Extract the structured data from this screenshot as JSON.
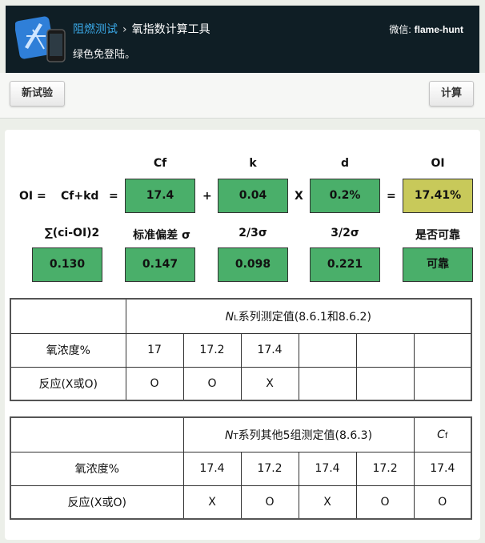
{
  "header": {
    "breadcrumb_link": "阻燃测试",
    "breadcrumb_sep": "›",
    "title": "氧指数计算工具",
    "subtitle": "绿色免登陆。",
    "wechat_label": "微信:",
    "wechat_id": "flame-hunt"
  },
  "toolbar": {
    "new_label": "新试验",
    "calc_label": "计算"
  },
  "formula": {
    "oi_label": "OI =",
    "expr": "Cf+kd",
    "eq1": "=",
    "plus": "+",
    "times": "X",
    "eq2": "=",
    "headers": {
      "cf": "Cf",
      "k": "k",
      "d": "d",
      "oi": "OI"
    },
    "values": {
      "cf": "17.4",
      "k": "0.04",
      "d": "0.2%",
      "oi": "17.41%"
    }
  },
  "stats": {
    "headers": {
      "sum": "∑(ci-OI)2",
      "std": "标准偏差 σ",
      "two_thirds": "2/3σ",
      "three_halves": "3/2σ",
      "reliable": "是否可靠"
    },
    "values": {
      "sum": "0.130",
      "std": "0.147",
      "two_thirds": "0.098",
      "three_halves": "0.221",
      "reliable": "可靠"
    }
  },
  "table_nl": {
    "title_prefix": "N",
    "title_sub": "L",
    "title_rest": "系列测定值(8.6.1和8.6.2)",
    "row1_label": "氧浓度%",
    "row2_label": "反应(X或O)",
    "concentrations": [
      "17",
      "17.2",
      "17.4",
      "",
      "",
      ""
    ],
    "reactions": [
      "O",
      "O",
      "X",
      "",
      "",
      ""
    ]
  },
  "table_nt": {
    "title_prefix": "N",
    "title_sub": "T",
    "title_rest": "系列其他5组测定值(8.6.3)",
    "cf_prefix": "C",
    "cf_sub": "f",
    "row1_label": "氧浓度%",
    "row2_label": "反应(X或O)",
    "concentrations": [
      "17.4",
      "17.2",
      "17.4",
      "17.2",
      "17.4"
    ],
    "reactions": [
      "X",
      "O",
      "X",
      "O",
      "O"
    ]
  }
}
